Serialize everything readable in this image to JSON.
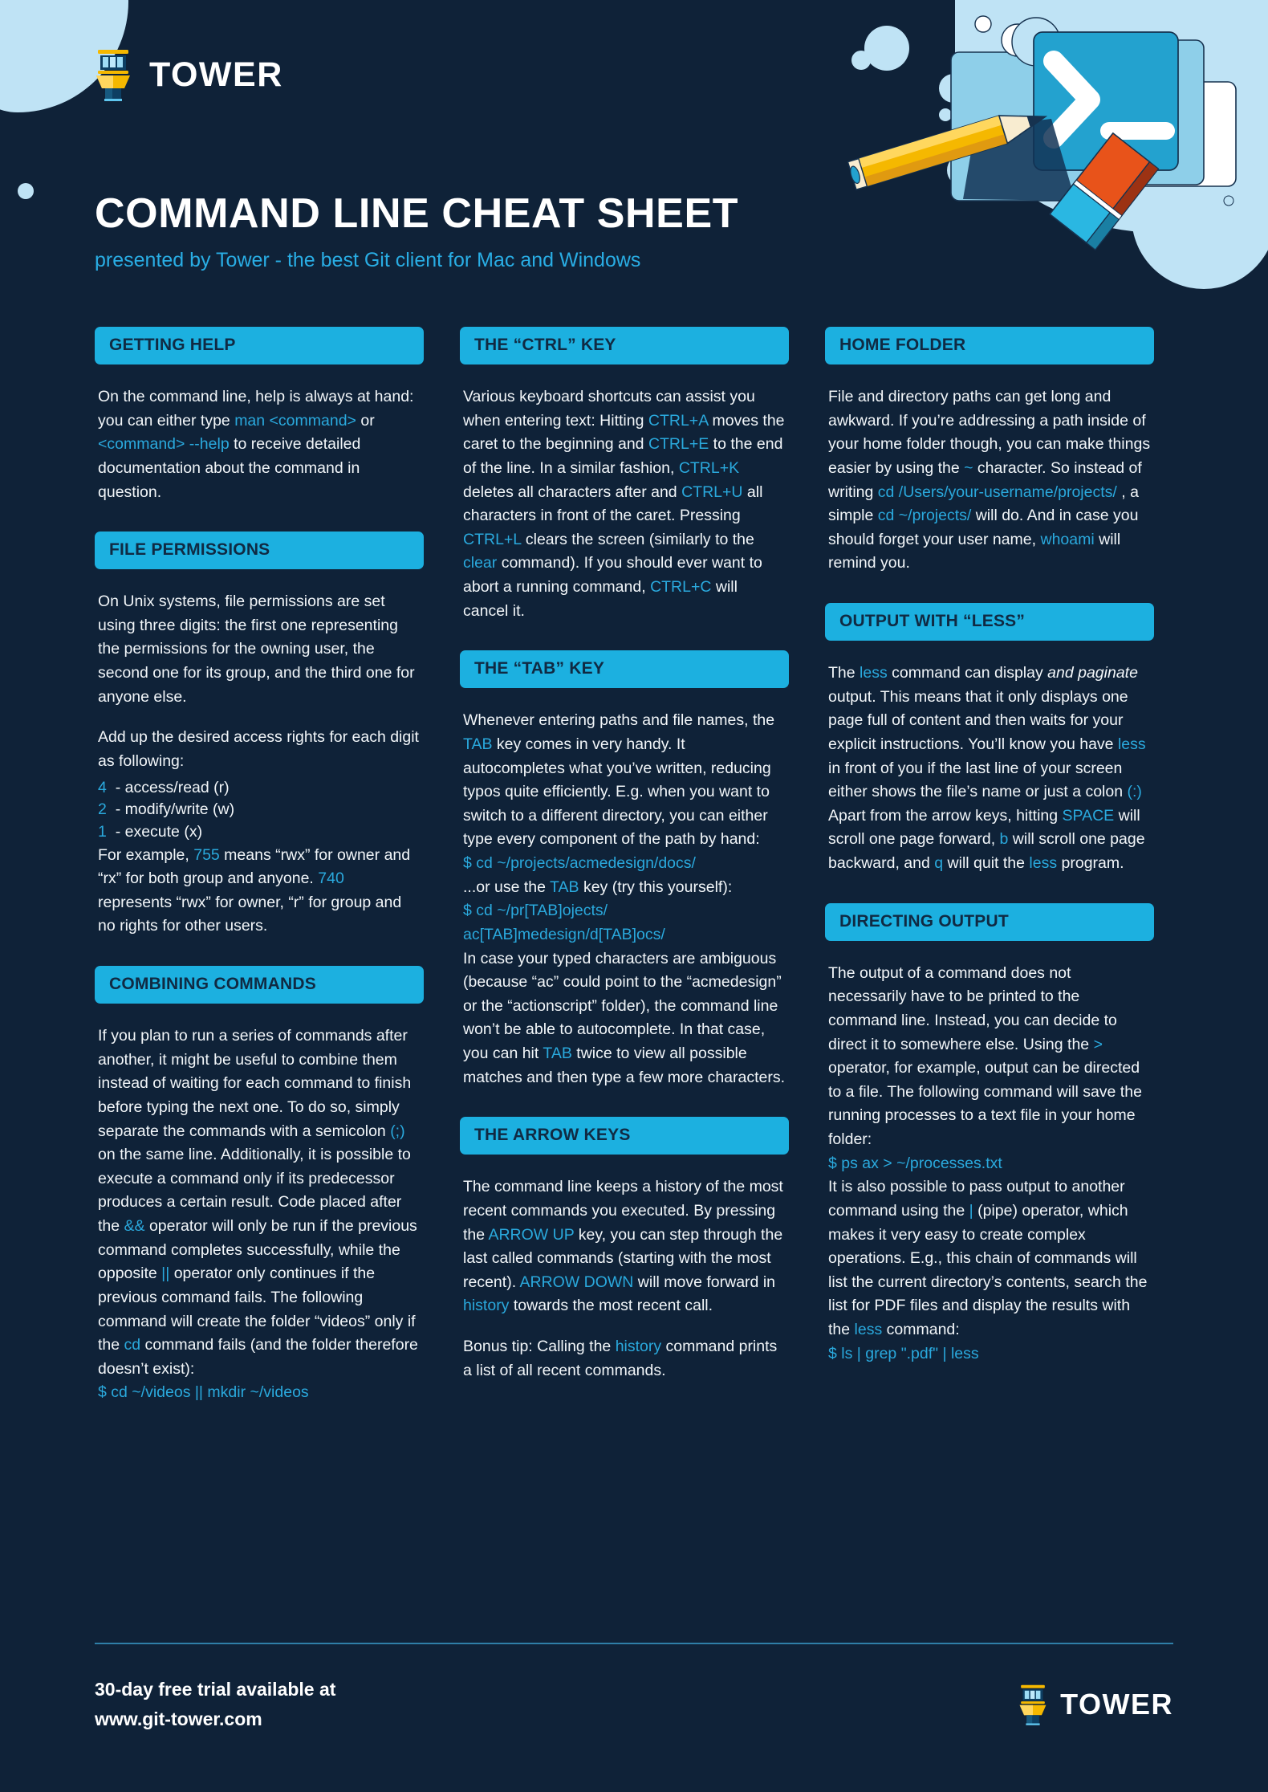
{
  "brand": {
    "name": "TOWER",
    "logo_icon": "tower-logo-icon"
  },
  "header": {
    "title": "COMMAND LINE CHEAT SHEET",
    "subtitle": "presented by Tower - the best Git client for Mac and Windows",
    "illustration_icon": "terminal-pencil-eraser-illustration"
  },
  "colors": {
    "background": "#0f2238",
    "accent": "#1cb0e0",
    "code": "#2aa9dd",
    "header_text": "#102a43",
    "body_text": "#f2f6f9",
    "blob": "#bfe3f5",
    "footer_rule": "#2f7fa8"
  },
  "columns": [
    {
      "sections": [
        {
          "id": "getting-help",
          "title": "GETTING HELP",
          "paragraphs": [
            [
              {
                "t": "On the command line, help is always at hand: you can either type "
              },
              {
                "t": "man <command>",
                "c": true
              },
              {
                "t": " or "
              },
              {
                "t": "<command> --help",
                "c": true
              },
              {
                "t": " to receive detailed documentation about the command in question."
              }
            ]
          ]
        },
        {
          "id": "file-permissions",
          "title": "FILE PERMISSIONS",
          "paragraphs": [
            [
              {
                "t": "On Unix systems, file permissions are set using three digits: the first one representing the permissions for the owning user, the second one for its group, and the third one for anyone else."
              }
            ],
            [
              {
                "t": "Add up the desired access rights for each digit as following:"
              }
            ]
          ],
          "permission_list": [
            {
              "digit": "4",
              "label": "- access/read (r)"
            },
            {
              "digit": "2",
              "label": "- modify/write (w)"
            },
            {
              "digit": "1",
              "label": "- execute (x)"
            }
          ],
          "trailing_paragraphs": [
            [
              {
                "t": "For example, "
              },
              {
                "t": "755",
                "c": true
              },
              {
                "t": " means “rwx” for owner and “rx” for both group and anyone. "
              },
              {
                "t": "740",
                "c": true
              },
              {
                "t": " represents “rwx” for owner, “r” for group and no rights for other users."
              }
            ]
          ]
        },
        {
          "id": "combining-commands",
          "title": "COMBINING COMMANDS",
          "paragraphs": [
            [
              {
                "t": "If you plan to run a series of commands after another, it might be useful to combine them instead of waiting for each command to finish before typing the next one. To do so, simply separate the commands with a semicolon "
              },
              {
                "t": "(;)",
                "c": true
              },
              {
                "t": " on the same line. Additionally, it is possible to execute a command only if its predecessor produces a certain result. Code placed after the "
              },
              {
                "t": "&&",
                "c": true
              },
              {
                "t": " operator will only be run if the previous command completes successfully, while the opposite "
              },
              {
                "t": "||",
                "c": true
              },
              {
                "t": " operator only continues if the previous command fails. The following command will create the folder “videos” only if the "
              },
              {
                "t": "cd",
                "c": true
              },
              {
                "t": " command fails (and the folder therefore doesn’t exist):"
              }
            ]
          ],
          "commands": [
            "$ cd ~/videos || mkdir ~/videos"
          ]
        }
      ]
    },
    {
      "sections": [
        {
          "id": "ctrl-key",
          "title": "THE “CTRL” KEY",
          "paragraphs": [
            [
              {
                "t": "Various keyboard shortcuts can assist you when entering text: Hitting "
              },
              {
                "t": "CTRL+A",
                "c": true
              },
              {
                "t": " moves the caret to the beginning and "
              },
              {
                "t": "CTRL+E",
                "c": true
              },
              {
                "t": " to the end of the line. In a similar fashion, "
              },
              {
                "t": "CTRL+K",
                "c": true
              },
              {
                "t": " deletes all characters after and "
              },
              {
                "t": "CTRL+U",
                "c": true
              },
              {
                "t": " all characters in front of the caret. Pressing "
              },
              {
                "t": "CTRL+L",
                "c": true
              },
              {
                "t": " clears the screen (similarly to the "
              },
              {
                "t": "clear",
                "c": true
              },
              {
                "t": " command). If you should ever want to abort a running command, "
              },
              {
                "t": "CTRL+C",
                "c": true
              },
              {
                "t": " will cancel it."
              }
            ]
          ]
        },
        {
          "id": "tab-key",
          "title": "THE “TAB” KEY",
          "paragraphs": [
            [
              {
                "t": "Whenever entering paths and file names, the "
              },
              {
                "t": "TAB",
                "c": true
              },
              {
                "t": " key comes in very handy. It autocompletes what you’ve written, reducing typos quite efficiently. E.g. when you want to switch to a different directory, you can either type every component of the path by hand:"
              }
            ]
          ],
          "commands": [
            "$ cd ~/projects/acmedesign/docs/"
          ],
          "paragraphs2": [
            [
              {
                "t": "...or use the "
              },
              {
                "t": "TAB",
                "c": true
              },
              {
                "t": " key (try this yourself):"
              }
            ]
          ],
          "commands2": [
            "$ cd ~/pr[TAB]ojects/",
            "ac[TAB]medesign/d[TAB]ocs/"
          ],
          "paragraphs3": [
            [
              {
                "t": "In case your typed characters are ambiguous (because “ac” could point to the “acmedesign” or the “actionscript” folder), the command line won’t be able to autocomplete. In that case, you can hit "
              },
              {
                "t": "TAB",
                "c": true
              },
              {
                "t": " twice to view all possible matches and then type a few more characters."
              }
            ]
          ]
        },
        {
          "id": "arrow-keys",
          "title": "THE ARROW KEYS",
          "paragraphs": [
            [
              {
                "t": "The command line keeps a history of the most recent commands you executed. By pressing the "
              },
              {
                "t": "ARROW UP",
                "c": true
              },
              {
                "t": " key, you can step through the last called commands (starting with the most recent). "
              },
              {
                "t": "ARROW DOWN",
                "c": true
              },
              {
                "t": " will move forward in "
              },
              {
                "t": "history",
                "c": true
              },
              {
                "t": " towards the most recent call."
              }
            ],
            [
              {
                "t": "Bonus tip: Calling the "
              },
              {
                "t": "history",
                "c": true
              },
              {
                "t": " command prints a list of all recent commands."
              }
            ]
          ]
        }
      ]
    },
    {
      "sections": [
        {
          "id": "home-folder",
          "title": "HOME FOLDER",
          "paragraphs": [
            [
              {
                "t": "File and directory paths can get long and awkward. If you’re addressing a path inside of your home folder though, you can make things easier by using the "
              },
              {
                "t": "~",
                "c": true
              },
              {
                "t": " character. So instead of writing "
              },
              {
                "t": "cd /Users/your-username/projects/",
                "c": true
              },
              {
                "t": " , a simple "
              },
              {
                "t": "cd ~/projects/",
                "c": true
              },
              {
                "t": " will do. And in case you should forget your user name, "
              },
              {
                "t": "whoami",
                "c": true
              },
              {
                "t": " will remind you."
              }
            ]
          ]
        },
        {
          "id": "output-with-less",
          "title": "OUTPUT WITH “LESS”",
          "paragraphs": [
            [
              {
                "t": "The "
              },
              {
                "t": "less",
                "c": true
              },
              {
                "t": " command can display "
              },
              {
                "t": "and paginate",
                "i": true
              },
              {
                "t": " output. This means that it only displays one page full of content and then waits for your explicit instructions. You’ll know you have "
              },
              {
                "t": "less",
                "c": true
              },
              {
                "t": " in front of you if the last line of your screen either shows the file’s name or just a colon "
              },
              {
                "t": "(:)",
                "c": true
              },
              {
                "t": " Apart from the arrow keys, hitting "
              },
              {
                "t": "SPACE",
                "c": true
              },
              {
                "t": " will scroll one page forward, "
              },
              {
                "t": "b",
                "c": true
              },
              {
                "t": " will scroll one page backward, and "
              },
              {
                "t": "q",
                "c": true
              },
              {
                "t": " will quit the "
              },
              {
                "t": "less",
                "c": true
              },
              {
                "t": " program."
              }
            ]
          ]
        },
        {
          "id": "directing-output",
          "title": "DIRECTING OUTPUT",
          "paragraphs": [
            [
              {
                "t": "The output of a command does not necessarily have to be printed to the command line. Instead, you can decide to direct it to somewhere else. Using the "
              },
              {
                "t": ">",
                "c": true
              },
              {
                "t": " operator, for example, output can be directed to a file. The following command will save the running processes to a text file in your home folder:"
              }
            ]
          ],
          "commands": [
            "$ ps ax > ~/processes.txt"
          ],
          "paragraphs2": [
            [
              {
                "t": "It is also possible to pass output to another command using the "
              },
              {
                "t": "|",
                "c": true
              },
              {
                "t": " (pipe) operator, which makes it very easy to create complex operations. E.g., this chain of commands will list the current directory’s contents, search the list for PDF files and display the results with the "
              },
              {
                "t": "less",
                "c": true
              },
              {
                "t": " command:"
              }
            ]
          ],
          "commands2": [
            "$ ls | grep \".pdf\" | less"
          ]
        }
      ]
    }
  ],
  "footer": {
    "line1": "30-day free trial available at",
    "line2": "www.git-tower.com",
    "logo_name": "TOWER"
  }
}
